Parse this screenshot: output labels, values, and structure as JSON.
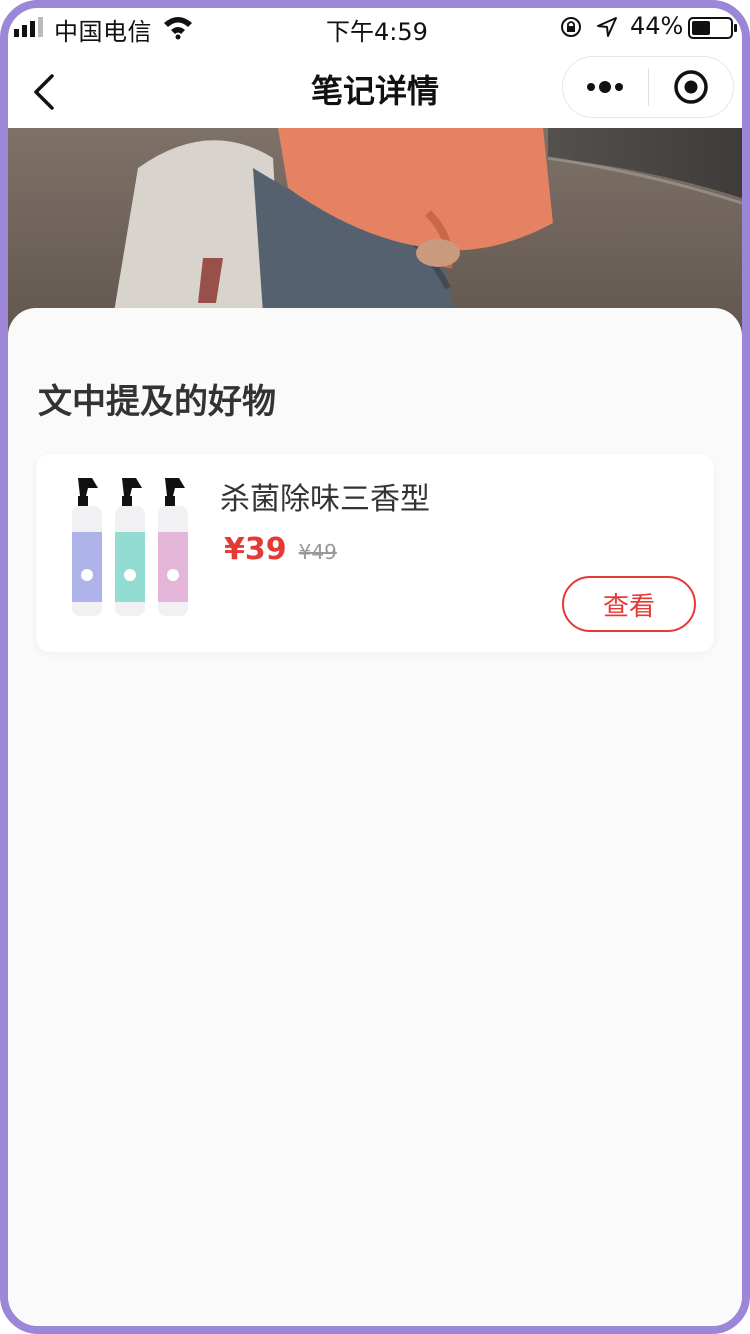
{
  "status_bar": {
    "carrier": "中国电信",
    "time": "下午4:59",
    "battery": "44%"
  },
  "nav": {
    "title": "笔记详情",
    "icons": [
      "back-chevron-icon",
      "more-dots-icon",
      "target-icon"
    ]
  },
  "section": {
    "title": "文中提及的好物"
  },
  "product": {
    "name": "杀菌除味三香型",
    "price": "¥39",
    "original_price": "¥49",
    "view_label": "查看"
  },
  "colors": {
    "frame": "#9b86d8",
    "accent": "#e53935",
    "sheet_bg": "#fafafa"
  }
}
